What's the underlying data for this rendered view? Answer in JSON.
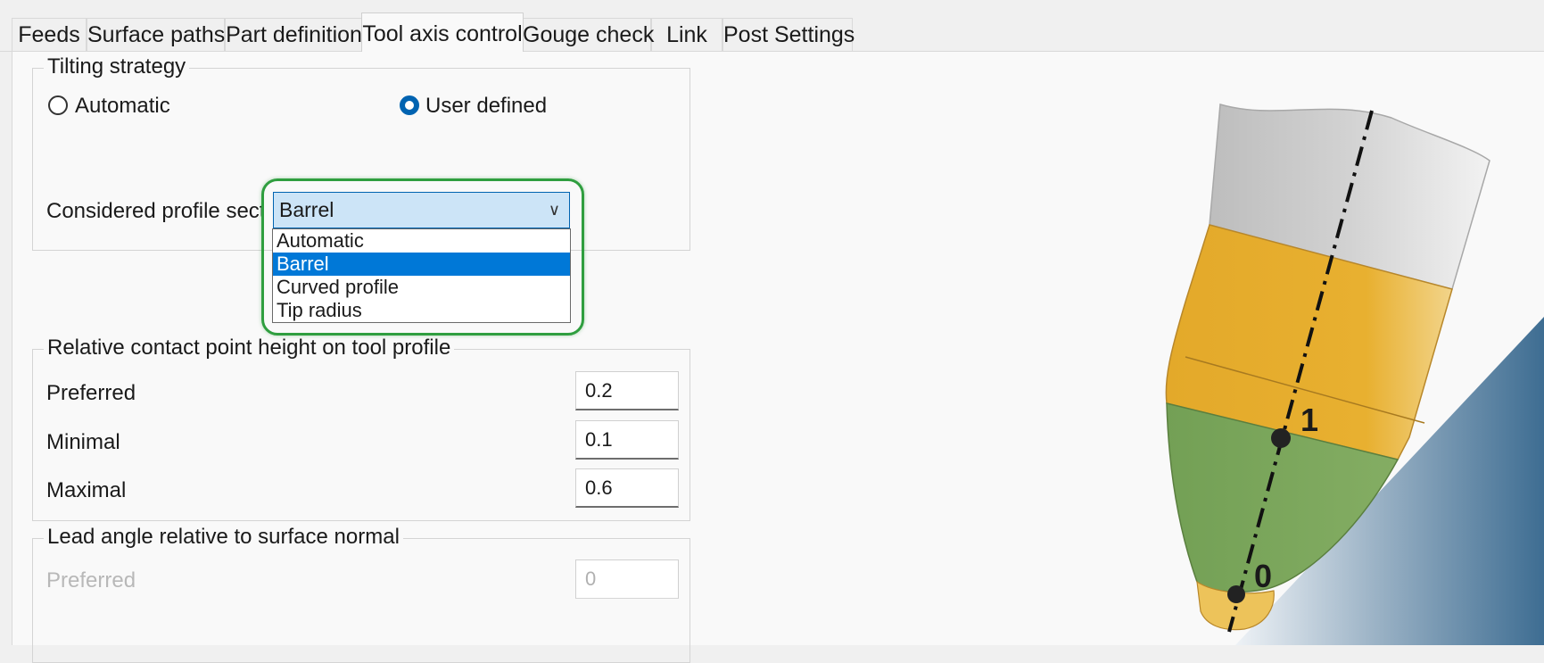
{
  "tabs": [
    {
      "label": "Feeds",
      "active": false
    },
    {
      "label": "Surface paths",
      "active": false
    },
    {
      "label": "Part definition",
      "active": false
    },
    {
      "label": "Tool axis control",
      "active": true
    },
    {
      "label": "Gouge check",
      "active": false
    },
    {
      "label": "Link",
      "active": false
    },
    {
      "label": "Post Settings",
      "active": false
    }
  ],
  "tilting": {
    "title": "Tilting strategy",
    "automatic_label": "Automatic",
    "user_defined_label": "User defined",
    "selected": "User defined",
    "profile_label": "Considered profile section",
    "profile_value": "Barrel",
    "dropdown_options": [
      "Automatic",
      "Barrel",
      "Curved profile",
      "Tip radius"
    ],
    "selected_option": "Barrel"
  },
  "contact": {
    "title": "Relative contact point height on tool profile",
    "preferred_label": "Preferred",
    "preferred_value": "0.2",
    "minimal_label": "Minimal",
    "minimal_value": "0.1",
    "maximal_label": "Maximal",
    "maximal_value": "0.6"
  },
  "lead": {
    "title": "Lead angle relative to surface normal",
    "preferred_label": "Preferred",
    "preferred_value": "0"
  },
  "illustration": {
    "label_1": "1",
    "label_0": "0"
  },
  "colors": {
    "highlight": "#2f9e3f",
    "selected": "#0078d7",
    "tool_yellow": "#e8b030",
    "tool_green": "#7aa45c",
    "tool_gray": "#c9c9c9"
  }
}
